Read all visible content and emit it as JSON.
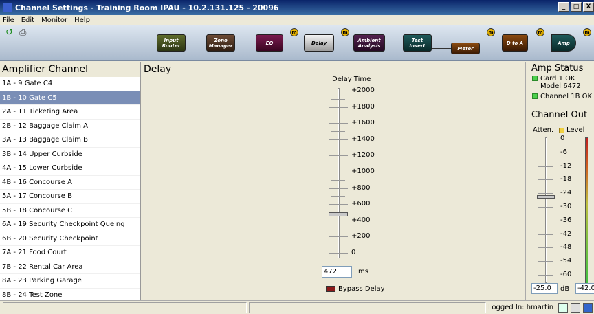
{
  "window": {
    "title": "Channel Settings - Training Room IPAU - 10.2.131.125 - 20096",
    "btn_min": "_",
    "btn_max": "□",
    "btn_close": "X"
  },
  "menu": [
    "File",
    "Edit",
    "Monitor",
    "Help"
  ],
  "toolbar": {
    "back_icon": "back-arrow-icon",
    "print_icon": "printer-icon",
    "back_glyph": "↺",
    "print_glyph": "⎙"
  },
  "pipeline": {
    "stages": [
      "Input Router",
      "Zone Manager",
      "EQ",
      "Delay",
      "Ambient Analysis",
      "Test Insert",
      "Meter",
      "D to A",
      "Amp"
    ],
    "monitor_badge": "m"
  },
  "channels": {
    "heading": "Amplifier Channel",
    "selected_index": 1,
    "items": [
      "1A - 9 Gate C4",
      "1B - 10 Gate C5",
      "2A - 11 Ticketing Area",
      "2B - 12 Baggage Claim A",
      "3A - 13 Baggage Claim B",
      "3B - 14 Upper Curbside",
      "4A - 15 Lower Curbside",
      "4B - 16 Concourse A",
      "5A - 17 Concourse B",
      "5B - 18 Concourse C",
      "6A - 19 Security Checkpoint Queing",
      "6B - 20 Security Checkpoint",
      "7A - 21 Food Court",
      "7B - 22 Rental Car Area",
      "8A - 23 Parking Garage",
      "8B - 24 Test Zone"
    ]
  },
  "delay": {
    "heading": "Delay",
    "slider_label": "Delay Time",
    "ticks": [
      "+2000",
      "+1800",
      "+1600",
      "+1400",
      "+1200",
      "+1000",
      "+800",
      "+600",
      "+400",
      "+200",
      "0"
    ],
    "value": "472",
    "value_fraction": 0.236,
    "unit": "ms",
    "bypass_label": "Bypass Delay"
  },
  "amp": {
    "status_heading": "Amp Status",
    "card_status": "Card 1 OK",
    "model": "Model 6472",
    "channel_status": "Channel 1B OK",
    "status_color": "#4cd04c",
    "out_heading": "Channel Out",
    "atten_label": "Atten.",
    "level_label": "Level",
    "atten_ticks": [
      "0",
      "-6",
      "-12",
      "-18",
      "-24",
      "-30",
      "-36",
      "-42",
      "-48",
      "-54",
      "-60"
    ],
    "atten_value": "-25.0",
    "atten_unit": "dB",
    "level_value": "-42.0"
  },
  "statusbar": {
    "login": "Logged In:  hmartin"
  }
}
